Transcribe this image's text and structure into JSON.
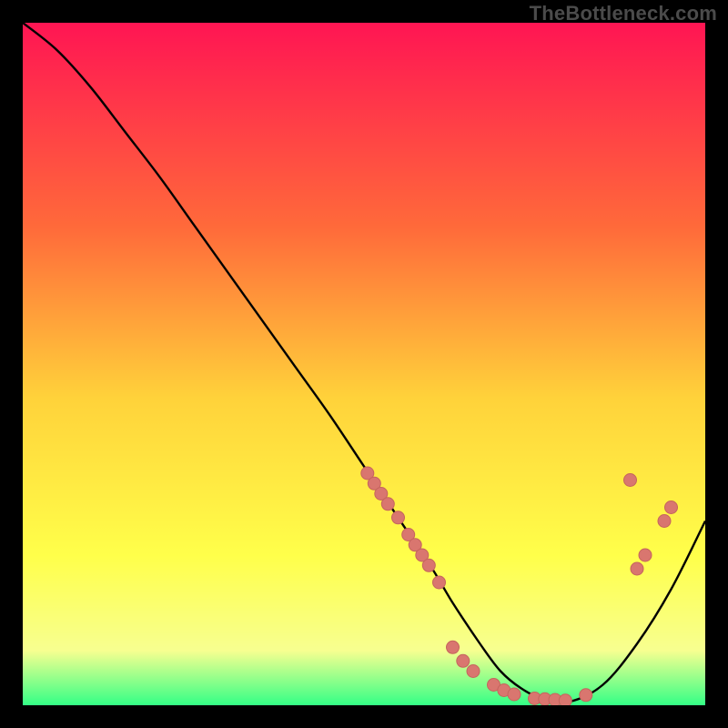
{
  "watermark": "TheBottleneck.com",
  "colors": {
    "gradient_top": "#ff1553",
    "gradient_mid1": "#ff6a3a",
    "gradient_mid2": "#ffd23a",
    "gradient_mid3": "#ffff4a",
    "gradient_bottom1": "#f7ff90",
    "gradient_bottom2": "#34ff86",
    "curve": "#000000",
    "marker_fill": "#d9766f",
    "marker_stroke": "#c5645d"
  },
  "chart_data": {
    "type": "line",
    "title": "",
    "xlabel": "",
    "ylabel": "",
    "xlim": [
      0,
      100
    ],
    "ylim": [
      0,
      100
    ],
    "grid": false,
    "legend": false,
    "series": [
      {
        "name": "bottleneck-curve",
        "x": [
          0,
          5,
          10,
          15,
          20,
          25,
          30,
          35,
          40,
          45,
          50,
          55,
          60,
          63,
          67,
          70,
          73,
          76,
          80,
          85,
          90,
          95,
          100
        ],
        "y": [
          100,
          96,
          90.5,
          84,
          77.5,
          70.5,
          63.5,
          56.5,
          49.5,
          42.5,
          35,
          27.5,
          20,
          15,
          9,
          5,
          2.5,
          1,
          0.5,
          3,
          9,
          17,
          27
        ]
      }
    ],
    "markers": [
      {
        "x": 50.5,
        "y": 34.0
      },
      {
        "x": 51.5,
        "y": 32.5
      },
      {
        "x": 52.5,
        "y": 31.0
      },
      {
        "x": 53.5,
        "y": 29.5
      },
      {
        "x": 55.0,
        "y": 27.5
      },
      {
        "x": 56.5,
        "y": 25.0
      },
      {
        "x": 57.5,
        "y": 23.5
      },
      {
        "x": 58.5,
        "y": 22.0
      },
      {
        "x": 59.5,
        "y": 20.5
      },
      {
        "x": 61.0,
        "y": 18.0
      },
      {
        "x": 63.0,
        "y": 8.5
      },
      {
        "x": 64.5,
        "y": 6.5
      },
      {
        "x": 66.0,
        "y": 5.0
      },
      {
        "x": 69.0,
        "y": 3.0
      },
      {
        "x": 70.5,
        "y": 2.2
      },
      {
        "x": 72.0,
        "y": 1.6
      },
      {
        "x": 75.0,
        "y": 1.0
      },
      {
        "x": 76.5,
        "y": 0.9
      },
      {
        "x": 78.0,
        "y": 0.8
      },
      {
        "x": 79.5,
        "y": 0.7
      },
      {
        "x": 82.5,
        "y": 1.5
      },
      {
        "x": 90.0,
        "y": 20.0
      },
      {
        "x": 91.2,
        "y": 22.0
      },
      {
        "x": 94.0,
        "y": 27.0
      },
      {
        "x": 95.0,
        "y": 29.0
      },
      {
        "x": 89.0,
        "y": 33.0
      }
    ]
  }
}
